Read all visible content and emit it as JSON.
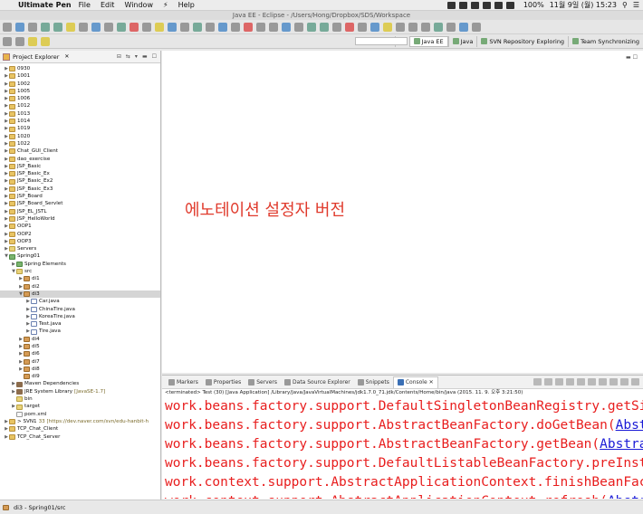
{
  "menubar": {
    "app_name": "Ultimate Pen",
    "items": [
      "File",
      "Edit",
      "Window",
      "Help"
    ],
    "battery": "100%",
    "clock": "11월 9일 (월) 15:23"
  },
  "window": {
    "title": "Java EE - Eclipse - /Users/Hong/Dropbox/SDS/Workspace"
  },
  "perspectives": [
    {
      "label": "Java EE",
      "active": true
    },
    {
      "label": "Java",
      "active": false
    },
    {
      "label": "SVN Repository Exploring",
      "active": false
    },
    {
      "label": "Team Synchronizing",
      "active": false
    }
  ],
  "explorer": {
    "title": "Project Explorer",
    "close_glyph": "✕",
    "items": [
      {
        "label": "0930",
        "icon": "project",
        "indent": 0,
        "arrow": "▶"
      },
      {
        "label": "1001",
        "icon": "project",
        "indent": 0,
        "arrow": "▶"
      },
      {
        "label": "1002",
        "icon": "project",
        "indent": 0,
        "arrow": "▶"
      },
      {
        "label": "1005",
        "icon": "project",
        "indent": 0,
        "arrow": "▶"
      },
      {
        "label": "1006",
        "icon": "project",
        "indent": 0,
        "arrow": "▶"
      },
      {
        "label": "1012",
        "icon": "project",
        "indent": 0,
        "arrow": "▶"
      },
      {
        "label": "1013",
        "icon": "project",
        "indent": 0,
        "arrow": "▶"
      },
      {
        "label": "1014",
        "icon": "project",
        "indent": 0,
        "arrow": "▶"
      },
      {
        "label": "1019",
        "icon": "project",
        "indent": 0,
        "arrow": "▶"
      },
      {
        "label": "1020",
        "icon": "project",
        "indent": 0,
        "arrow": "▶"
      },
      {
        "label": "1022",
        "icon": "project",
        "indent": 0,
        "arrow": "▶"
      },
      {
        "label": "Chat_GUI_Client",
        "icon": "project",
        "indent": 0,
        "arrow": "▶"
      },
      {
        "label": "dao_exercise",
        "icon": "project",
        "indent": 0,
        "arrow": "▶"
      },
      {
        "label": "JSP_Basic",
        "icon": "project",
        "indent": 0,
        "arrow": "▶"
      },
      {
        "label": "JSP_Basic_Ex",
        "icon": "project",
        "indent": 0,
        "arrow": "▶"
      },
      {
        "label": "JSP_Basic_Ex2",
        "icon": "project",
        "indent": 0,
        "arrow": "▶"
      },
      {
        "label": "JSP_Basic_Ex3",
        "icon": "project",
        "indent": 0,
        "arrow": "▶"
      },
      {
        "label": "JSP_Board",
        "icon": "project",
        "indent": 0,
        "arrow": "▶"
      },
      {
        "label": "JSP_Board_Servlet",
        "icon": "project",
        "indent": 0,
        "arrow": "▶"
      },
      {
        "label": "JSP_EL_JSTL",
        "icon": "project",
        "indent": 0,
        "arrow": "▶"
      },
      {
        "label": "JSP_HelloWorld",
        "icon": "project",
        "indent": 0,
        "arrow": "▶"
      },
      {
        "label": "OOP1",
        "icon": "project",
        "indent": 0,
        "arrow": "▶"
      },
      {
        "label": "OOP2",
        "icon": "project",
        "indent": 0,
        "arrow": "▶"
      },
      {
        "label": "OOP3",
        "icon": "project",
        "indent": 0,
        "arrow": "▶"
      },
      {
        "label": "Servers",
        "icon": "folder",
        "indent": 0,
        "arrow": "▶"
      },
      {
        "label": "Spring01",
        "icon": "spring",
        "indent": 0,
        "arrow": "▼"
      },
      {
        "label": "Spring Elements",
        "icon": "spring",
        "indent": 1,
        "arrow": "▶"
      },
      {
        "label": "src",
        "icon": "folder",
        "indent": 1,
        "arrow": "▼"
      },
      {
        "label": "di1",
        "icon": "package",
        "indent": 2,
        "arrow": "▶"
      },
      {
        "label": "di2",
        "icon": "package",
        "indent": 2,
        "arrow": "▶"
      },
      {
        "label": "di3",
        "icon": "package",
        "indent": 2,
        "arrow": "▼",
        "selected": true
      },
      {
        "label": "Car.java",
        "icon": "java",
        "indent": 3,
        "arrow": "▶"
      },
      {
        "label": "ChinaTire.java",
        "icon": "java",
        "indent": 3,
        "arrow": "▶"
      },
      {
        "label": "KoreaTire.java",
        "icon": "java",
        "indent": 3,
        "arrow": "▶"
      },
      {
        "label": "Test.java",
        "icon": "java",
        "indent": 3,
        "arrow": "▶"
      },
      {
        "label": "Tire.java",
        "icon": "java",
        "indent": 3,
        "arrow": "▶"
      },
      {
        "label": "di4",
        "icon": "package",
        "indent": 2,
        "arrow": "▶"
      },
      {
        "label": "di5",
        "icon": "package",
        "indent": 2,
        "arrow": "▶"
      },
      {
        "label": "di6",
        "icon": "package",
        "indent": 2,
        "arrow": "▶"
      },
      {
        "label": "di7",
        "icon": "package",
        "indent": 2,
        "arrow": "▶"
      },
      {
        "label": "di8",
        "icon": "package",
        "indent": 2,
        "arrow": "▶"
      },
      {
        "label": "di9",
        "icon": "package",
        "indent": 2,
        "arrow": ""
      },
      {
        "label": "Maven Dependencies",
        "icon": "library",
        "indent": 1,
        "arrow": "▶"
      },
      {
        "label": "JRE System Library",
        "suffix": "[JavaSE-1.7]",
        "icon": "library",
        "indent": 1,
        "arrow": "▶"
      },
      {
        "label": "bin",
        "icon": "folder",
        "indent": 1,
        "arrow": ""
      },
      {
        "label": "target",
        "icon": "folder",
        "indent": 1,
        "arrow": "▶"
      },
      {
        "label": "pom.xml",
        "icon": "file",
        "indent": 1,
        "arrow": ""
      },
      {
        "label": "> SVN1",
        "suffix": "33 [https://dev.naver.com/svn/edu-hanbit-h",
        "icon": "project",
        "indent": 0,
        "arrow": "▶"
      },
      {
        "label": "TCP_Chat_Client",
        "icon": "project",
        "indent": 0,
        "arrow": "▶"
      },
      {
        "label": "TCP_Chat_Server",
        "icon": "project",
        "indent": 0,
        "arrow": "▶"
      }
    ]
  },
  "editor": {
    "annotation": "에노테이션 설정자 버전"
  },
  "console": {
    "tabs": [
      {
        "label": "Markers",
        "active": false
      },
      {
        "label": "Properties",
        "active": false
      },
      {
        "label": "Servers",
        "active": false
      },
      {
        "label": "Data Source Explorer",
        "active": false
      },
      {
        "label": "Snippets",
        "active": false
      },
      {
        "label": "Console",
        "active": true,
        "close": "✕"
      }
    ],
    "terminated": "<terminated> Test (30) [Java Application] /Library/Java/JavaVirtualMachines/jdk1.7.0_71.jdk/Contents/Home/bin/java (2015. 11. 9. 오후 3:21:50)",
    "lines": [
      {
        "text": "work.beans.factory.support.DefaultSingletonBeanRegistry.getSi",
        "link": ""
      },
      {
        "text": "work.beans.factory.support.AbstractBeanFactory.doGetBean(",
        "link": "Abst"
      },
      {
        "text": "work.beans.factory.support.AbstractBeanFactory.getBean(",
        "link": "Abstra"
      },
      {
        "text": "work.beans.factory.support.DefaultListableBeanFactory.preInst",
        "link": ""
      },
      {
        "text": "work.context.support.AbstractApplicationContext.finishBeanFac",
        "link": ""
      },
      {
        "text": "work.context.support.AbstractApplicationContext.refresh(",
        "link": "Abstr"
      }
    ]
  },
  "statusbar": {
    "text": "di3 - Spring01/src"
  },
  "colors": {
    "annotation": "#e03a2c",
    "stacktrace": "#e81e1e",
    "link": "#1a1ad6",
    "selection": "#d5d5d5"
  }
}
